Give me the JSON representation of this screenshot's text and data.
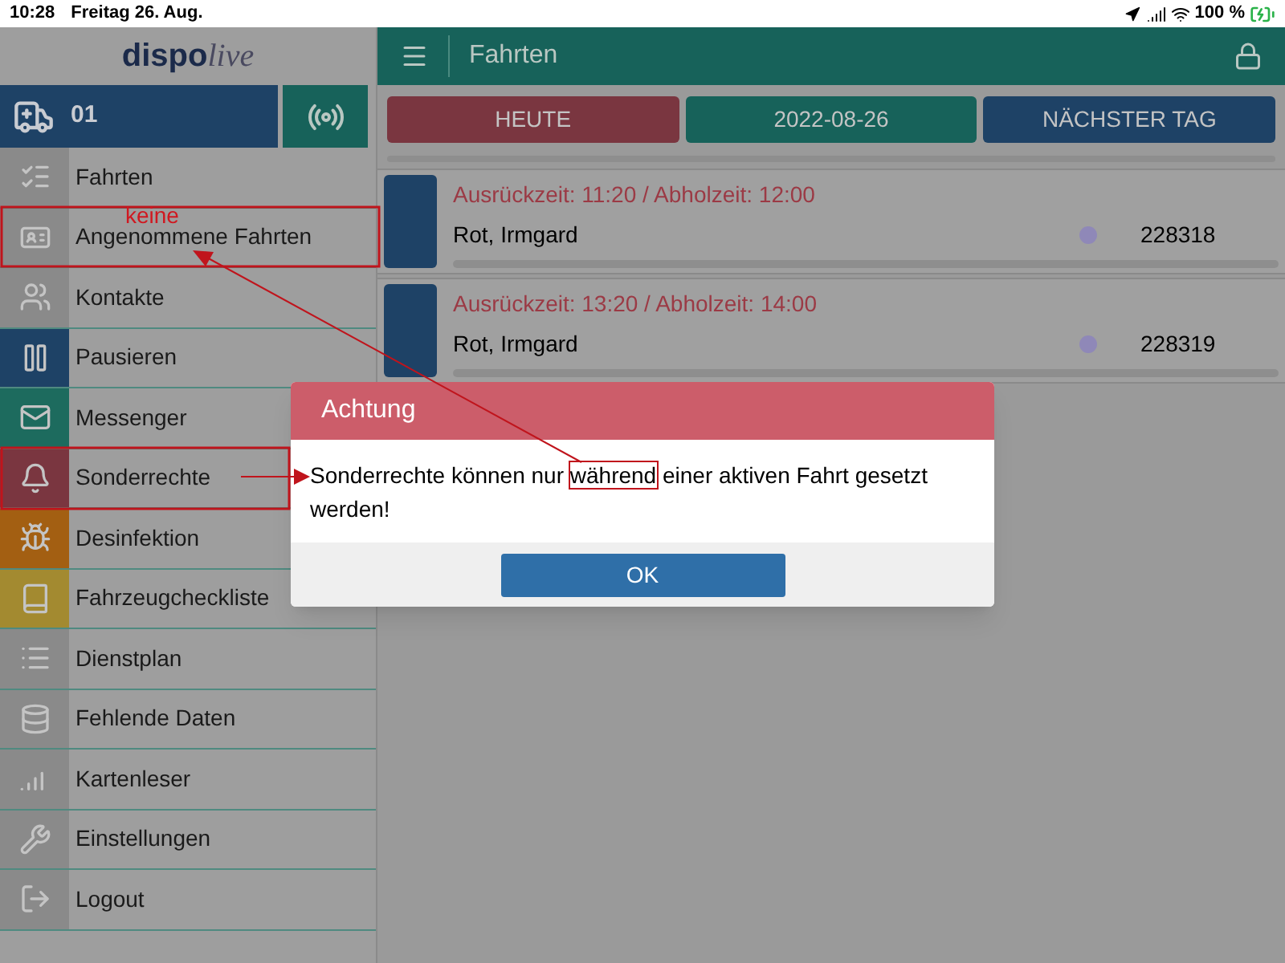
{
  "status_bar": {
    "time": "10:28",
    "date": "Freitag 26. Aug.",
    "battery": "100 %"
  },
  "sidebar": {
    "logo": {
      "part_1": "dispo",
      "part_2": "live"
    },
    "vehicle": "01",
    "items": [
      {
        "label": "Fahrten",
        "color": "#8a8a8a"
      },
      {
        "label": "Angenommene Fahrten",
        "color": "#8a8a8a"
      },
      {
        "label": "Kontakte",
        "color": "#8a8a8a"
      },
      {
        "label": "Pausieren",
        "color": "#1e4266"
      },
      {
        "label": "Messenger",
        "color": "#1d6b5e"
      },
      {
        "label": "Sonderrechte",
        "color": "#7a3640"
      },
      {
        "label": "Desinfektion",
        "color": "#a35f12"
      },
      {
        "label": "Fahrzeugcheckliste",
        "color": "#a38a30"
      },
      {
        "label": "Dienstplan",
        "color": "#8a8a8a"
      },
      {
        "label": "Fehlende Daten",
        "color": "#8a8a8a"
      },
      {
        "label": "Kartenleser",
        "color": "#8a8a8a"
      },
      {
        "label": "Einstellungen",
        "color": "#8a8a8a"
      },
      {
        "label": "Logout",
        "color": "#8a8a8a"
      }
    ]
  },
  "header": {
    "title": "Fahrten"
  },
  "day_buttons": [
    {
      "label": "HEUTE",
      "color": "#7a3640"
    },
    {
      "label": "2022-08-26",
      "color": "#17625a"
    },
    {
      "label": "NÄCHSTER TAG",
      "color": "#1e4266"
    }
  ],
  "trips": [
    {
      "times": "Ausrückzeit: 11:20 / Abholzeit: 12:00",
      "name": "Rot, Irmgard",
      "number": "228318"
    },
    {
      "times": "Ausrückzeit: 13:20 / Abholzeit: 14:00",
      "name": "Rot, Irmgard",
      "number": "228319"
    }
  ],
  "dialog": {
    "title": "Achtung",
    "message_before": "Sonderrechte können nur",
    "message_highlight": "während",
    "message_after": "einer aktiven Fahrt gesetzt werden!",
    "button": "OK"
  },
  "annotations": {
    "note": "keine"
  }
}
